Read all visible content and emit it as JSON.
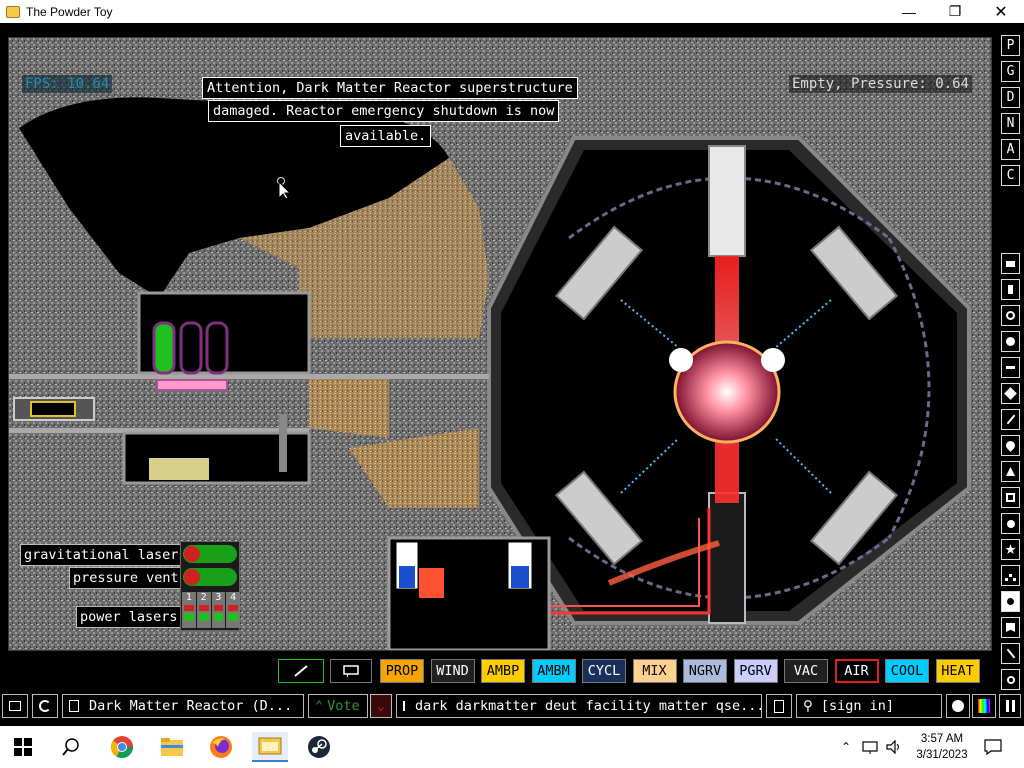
{
  "window": {
    "title": "The Powder Toy",
    "controls": [
      "minimize",
      "maximize",
      "close"
    ]
  },
  "hud": {
    "fps": "FPS: 10.64",
    "status": "Empty, Pressure: 0.64"
  },
  "notice": {
    "lines": [
      "Attention, Dark Matter Reactor superstructure",
      "damaged. Reactor emergency shutdown is now",
      "available."
    ]
  },
  "controls": {
    "gravitational_lasers": "gravitational lasers",
    "pressure_vent": "pressure vent",
    "power_lasers": "power lasers",
    "power_laser_numbers": [
      "1",
      "2",
      "3",
      "4"
    ]
  },
  "right_menu": {
    "top_buttons": [
      "P",
      "G",
      "D",
      "N",
      "A",
      "C"
    ],
    "category_icons": [
      "walls-icon",
      "electronics-icon",
      "powered-icon",
      "sensors-icon",
      "force-icon",
      "explosives-icon",
      "gases-icon",
      "liquids-icon",
      "powders-icon",
      "solids-icon",
      "radioactive-icon",
      "special-icon",
      "life-icon",
      "tools-icon",
      "favorites-icon",
      "decoration-icon",
      "search-icon"
    ]
  },
  "toolbar": {
    "elements": [
      {
        "label": "PROP",
        "bg": "#f5a400",
        "fg": "#000"
      },
      {
        "label": "WIND",
        "bg": "#202020",
        "fg": "#fff"
      },
      {
        "label": "AMBP",
        "bg": "#ffcc00",
        "fg": "#000"
      },
      {
        "label": "AMBM",
        "bg": "#00ccff",
        "fg": "#000"
      },
      {
        "label": "CYCL",
        "bg": "#1a2f5c",
        "fg": "#fff"
      },
      {
        "label": "MIX",
        "bg": "#ffd090",
        "fg": "#000"
      },
      {
        "label": "NGRV",
        "bg": "#aabbdd",
        "fg": "#000"
      },
      {
        "label": "PGRV",
        "bg": "#ccccff",
        "fg": "#000"
      },
      {
        "label": "VAC",
        "bg": "#202020",
        "fg": "#fff"
      },
      {
        "label": "AIR",
        "bg": "#000000",
        "fg": "#fff"
      },
      {
        "label": "COOL",
        "bg": "#00ccff",
        "fg": "#000"
      },
      {
        "label": "HEAT",
        "bg": "#ffcc00",
        "fg": "#000"
      }
    ]
  },
  "bottom_bar": {
    "save_name": "Dark Matter Reactor (D...",
    "vote": "Vote",
    "tags": "dark darkmatter deut facility matter qse...",
    "sign_in": "[sign in]"
  },
  "taskbar": {
    "time": "3:57 AM",
    "date": "3/31/2023",
    "apps": [
      "chrome-icon",
      "file-explorer-icon",
      "firefox-icon",
      "powder-toy-icon",
      "steam-icon"
    ]
  },
  "colors": {
    "fps_text": "#1e8fb4",
    "vote_green": "#2a9a2a",
    "air_selected_border": "#e02020"
  }
}
